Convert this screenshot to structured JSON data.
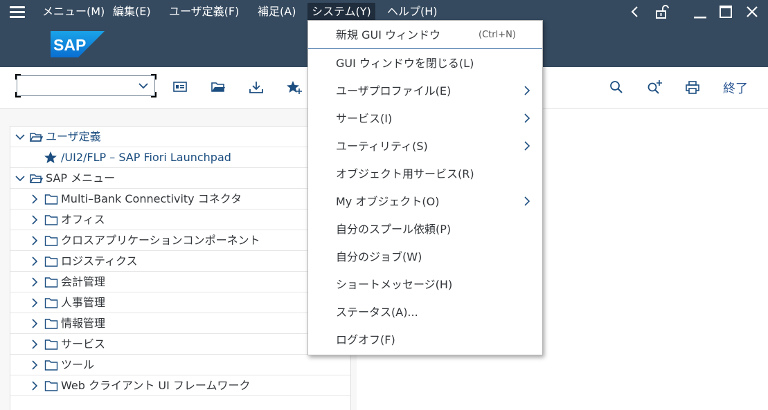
{
  "menubar": {
    "items": [
      {
        "label": "メニュー(M)"
      },
      {
        "label": "編集(E)"
      },
      {
        "label": "ユーザ定義(F)"
      },
      {
        "label": "補足(A)"
      },
      {
        "label": "システム(Y)",
        "active": true
      },
      {
        "label": "ヘルプ(H)"
      }
    ],
    "icons": [
      "menu-icon",
      "back-icon",
      "unlock-icon",
      "minimize-icon",
      "maximize-icon",
      "close-icon"
    ]
  },
  "shell": {
    "logo_text": "SAP"
  },
  "toolbar": {
    "command_field_value": "",
    "finish_label": "終了",
    "icons": [
      "user-card-icon",
      "open-folder-icon",
      "download-icon",
      "add-favorite-icon",
      "search-icon",
      "search-more-icon",
      "print-icon"
    ]
  },
  "tree": {
    "rows": [
      {
        "label": "ユーザ定義",
        "level": 0,
        "expanded": true,
        "icon": "open-folder-icon"
      },
      {
        "label": "/UI2/FLP – SAP Fiori Launchpad",
        "level": 1,
        "icon": "star-icon"
      },
      {
        "label": "SAP メニュー",
        "level": 0,
        "expanded": true,
        "icon": "open-folder-icon"
      },
      {
        "label": "Multi–Bank Connectivity コネクタ",
        "level": 1,
        "icon": "folder-icon"
      },
      {
        "label": "オフィス",
        "level": 1,
        "icon": "folder-icon"
      },
      {
        "label": "クロスアプリケーションコンポーネント",
        "level": 1,
        "icon": "folder-icon"
      },
      {
        "label": "ロジスティクス",
        "level": 1,
        "icon": "folder-icon"
      },
      {
        "label": "会計管理",
        "level": 1,
        "icon": "folder-icon"
      },
      {
        "label": "人事管理",
        "level": 1,
        "icon": "folder-icon"
      },
      {
        "label": "情報管理",
        "level": 1,
        "icon": "folder-icon"
      },
      {
        "label": "サービス",
        "level": 1,
        "icon": "folder-icon"
      },
      {
        "label": "ツール",
        "level": 1,
        "icon": "folder-icon"
      },
      {
        "label": "Web クライアント UI フレームワーク",
        "level": 1,
        "icon": "folder-icon"
      }
    ]
  },
  "dropdown": {
    "items": [
      {
        "label": "新規 GUI ウィンドウ",
        "shortcut": "(Ctrl+N)"
      },
      {
        "label": "GUI ウィンドウを閉じる(L)"
      },
      {
        "label": "ユーザプロファイル(E)",
        "submenu": true
      },
      {
        "label": "サービス(I)",
        "submenu": true
      },
      {
        "label": "ユーティリティ(S)",
        "submenu": true
      },
      {
        "label": "オブジェクト用サービス(R)"
      },
      {
        "label": "My オブジェクト(O)",
        "submenu": true
      },
      {
        "label": "自分のスプール依頼(P)"
      },
      {
        "label": "自分のジョブ(W)"
      },
      {
        "label": "ショートメッセージ(H)"
      },
      {
        "label": "ステータス(A)..."
      },
      {
        "label": "ログオフ(F)"
      }
    ]
  },
  "colors": {
    "shell": "#354a5f",
    "active_menu": "#1f2d3d",
    "accent_blue": "#1c4e80",
    "logo_blue": "#0a6ed1"
  }
}
